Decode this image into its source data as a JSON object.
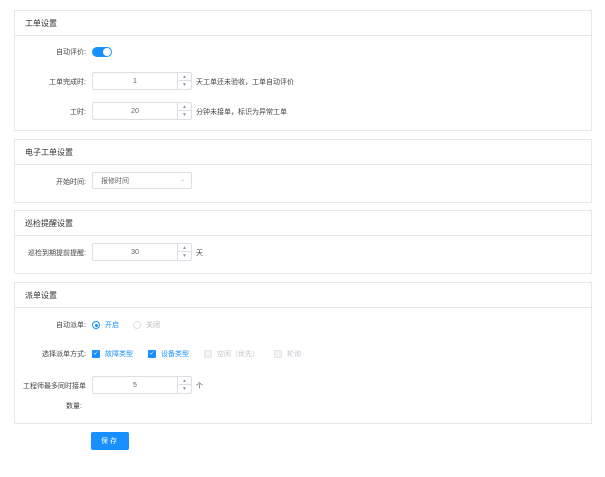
{
  "work_order": {
    "title": "工单设置",
    "auto_eval_label": "自动评价:",
    "auto_eval_on": true,
    "complete_label": "工单完成时:",
    "complete_value": "1",
    "complete_suffix": "天工单还未验收，工单自动评价",
    "timeout_label": "工时:",
    "timeout_value": "20",
    "timeout_suffix": "分钟未接单，标识为异常工单"
  },
  "e_order": {
    "title": "电子工单设置",
    "start_label": "开始时间:",
    "start_value": "报修时间"
  },
  "inspection": {
    "title": "巡检提醒设置",
    "advance_label": "巡检到期提前提醒:",
    "advance_value": "30",
    "advance_suffix": "天"
  },
  "dispatch": {
    "title": "派单设置",
    "auto_label": "自动派单:",
    "auto_options": [
      {
        "label": "开启",
        "selected": true
      },
      {
        "label": "关闭",
        "selected": false
      }
    ],
    "method_label": "选择派单方式:",
    "methods": [
      {
        "label": "故障类型",
        "checked": true,
        "disabled": false
      },
      {
        "label": "设备类型",
        "checked": true,
        "disabled": false
      },
      {
        "label": "空闲（优先）",
        "checked": false,
        "disabled": true
      },
      {
        "label": "轮询",
        "checked": false,
        "disabled": true
      }
    ],
    "max_label_line1": "工程师最多同时接单",
    "max_label_line2": "数量:",
    "max_value": "5",
    "max_suffix": "个"
  },
  "save_label": "保存",
  "colors": {
    "accent": "#1890ff",
    "border": "#e6e8eb",
    "disabled": "#c0c4cc"
  }
}
